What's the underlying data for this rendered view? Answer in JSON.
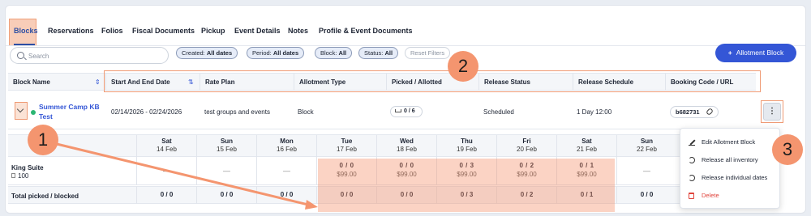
{
  "tabs": [
    {
      "label": "Blocks",
      "active": true
    },
    {
      "label": "Reservations"
    },
    {
      "label": "Folios"
    },
    {
      "label": "Fiscal Documents"
    },
    {
      "label": "Pickup"
    },
    {
      "label": "Event Details"
    },
    {
      "label": "Notes"
    },
    {
      "label": "Profile & Event Documents"
    }
  ],
  "filters": {
    "search_placeholder": "Search",
    "created_label": "Created:",
    "created_value": "All dates",
    "period_label": "Period:",
    "period_value": "All dates",
    "block_label": "Block:",
    "block_value": "All",
    "status_label": "Status:",
    "status_value": "All",
    "reset_label": "Reset Filters"
  },
  "actions": {
    "add_block_label": "Allotment Block"
  },
  "table": {
    "headers": [
      "Block Name",
      "Start And End Date",
      "Rate Plan",
      "Allotment Type",
      "Picked / Allotted",
      "Release Status",
      "Release Schedule",
      "Booking Code / URL"
    ],
    "row": {
      "name": "Summer Camp KB Test",
      "dates": "02/14/2026 - 02/24/2026",
      "rate_plan": "test groups and events",
      "allotment_type": "Block",
      "picked_allotted": "0 / 6",
      "release_status": "Scheduled",
      "release_schedule": "1 Day 12:00",
      "booking_code": "b682731"
    }
  },
  "calendar": {
    "days": [
      {
        "name": "Sat",
        "date": "14 Feb"
      },
      {
        "name": "Sun",
        "date": "15 Feb"
      },
      {
        "name": "Mon",
        "date": "16 Feb"
      },
      {
        "name": "Tue",
        "date": "17 Feb"
      },
      {
        "name": "Wed",
        "date": "18 Feb"
      },
      {
        "name": "Thu",
        "date": "19 Feb"
      },
      {
        "name": "Fri",
        "date": "20 Feb"
      },
      {
        "name": "Sat",
        "date": "21 Feb"
      },
      {
        "name": "Sun",
        "date": "22 Feb"
      }
    ],
    "room": {
      "name": "King Suite",
      "count": "100"
    },
    "room_cells": [
      {
        "dash": "—"
      },
      {
        "dash": "—"
      },
      {
        "dash": "—"
      },
      {
        "count": "0 / 0",
        "price": "$99.00"
      },
      {
        "count": "0 / 0",
        "price": "$99.00"
      },
      {
        "count": "0 / 3",
        "price": "$99.00"
      },
      {
        "count": "0 / 2",
        "price": "$99.00"
      },
      {
        "count": "0 / 1",
        "price": "$99.00"
      },
      {
        "dash": "—"
      }
    ],
    "total_label": "Total picked / blocked",
    "totals": [
      "0 / 0",
      "0 / 0",
      "0 / 0",
      "0 / 0",
      "0 / 0",
      "0 / 3",
      "0 / 2",
      "0 / 1",
      "0 / 0"
    ]
  },
  "menu": {
    "items": [
      {
        "label": "Edit Allotment Block",
        "icon": "pencil-icon"
      },
      {
        "label": "Release all inventory",
        "icon": "refresh-icon"
      },
      {
        "label": "Release individual dates",
        "icon": "refresh-icon"
      },
      {
        "label": "Delete",
        "icon": "trash-icon"
      }
    ]
  },
  "callouts": [
    "1",
    "2",
    "3"
  ],
  "colors": {
    "accent": "#3456d6",
    "highlight": "#f4956f",
    "status_green": "#2bb673",
    "danger": "#e0443c"
  }
}
